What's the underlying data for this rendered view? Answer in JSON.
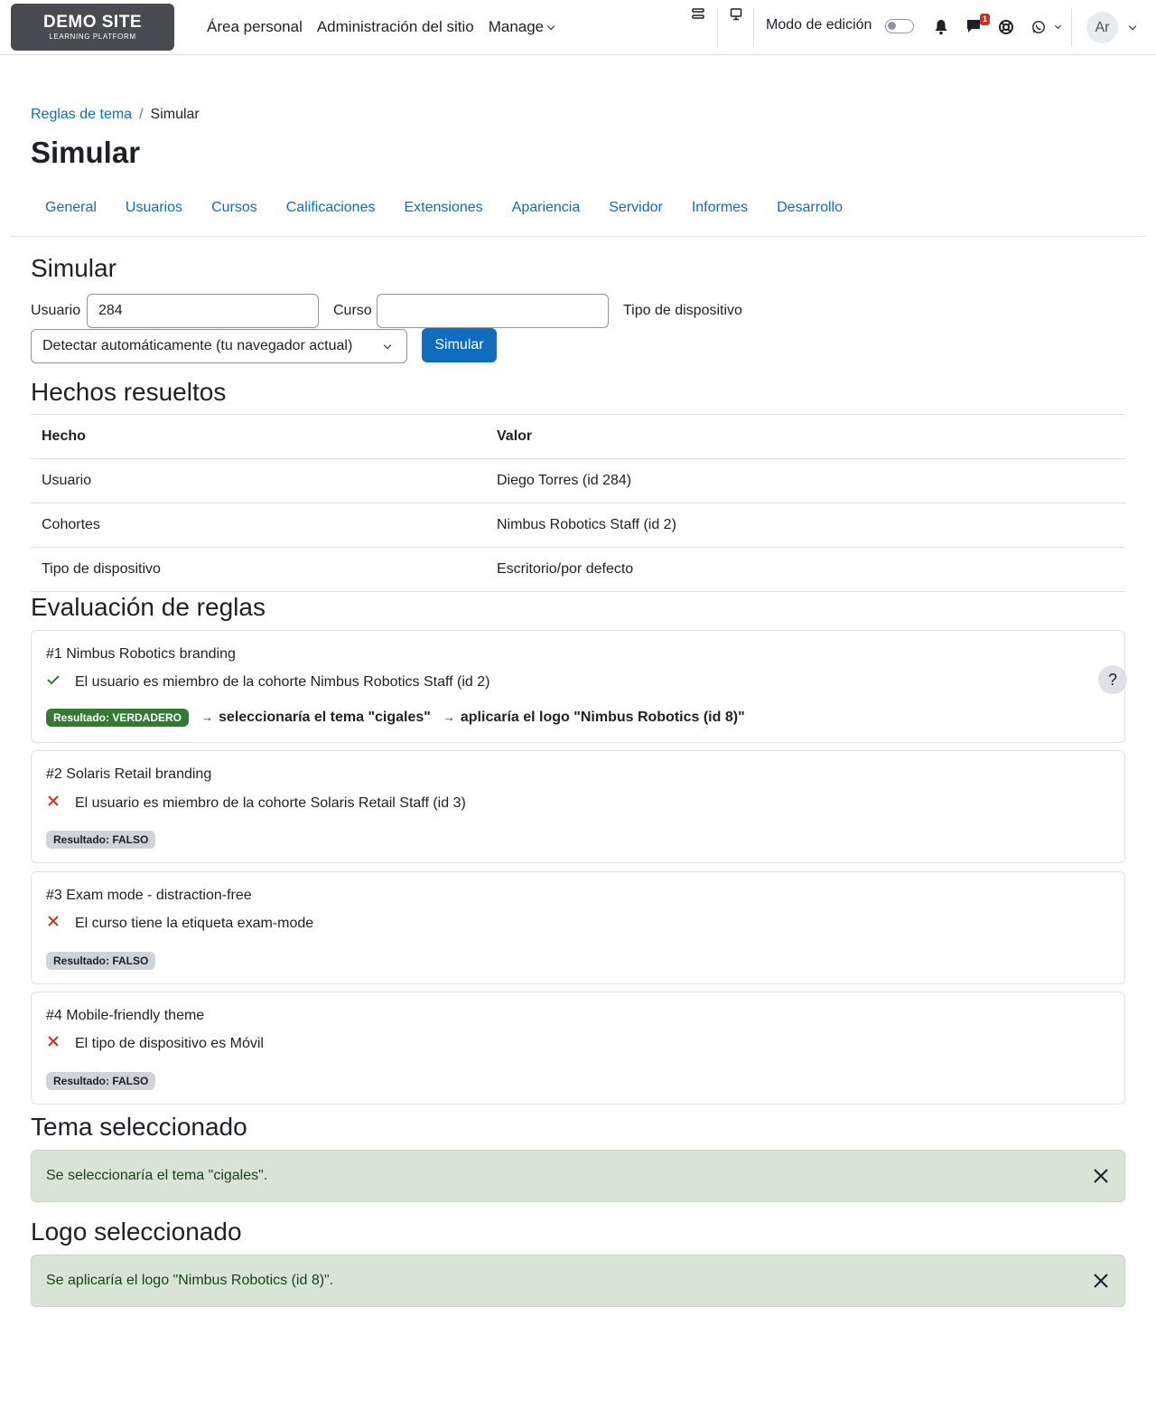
{
  "navbar": {
    "logo_title": "DEMO SITE",
    "logo_subtitle": "LEARNING PLATFORM",
    "primary": [
      "Área personal",
      "Administración del sitio",
      "Manage"
    ],
    "edit_mode_label": "Modo de edición",
    "message_count": "1",
    "avatar_initials": "Ar"
  },
  "breadcrumb": {
    "link": "Reglas de tema",
    "separator": "/",
    "current": "Simular"
  },
  "page_title": "Simular",
  "secondary_nav": [
    "General",
    "Usuarios",
    "Cursos",
    "Calificaciones",
    "Extensiones",
    "Apariencia",
    "Servidor",
    "Informes",
    "Desarrollo"
  ],
  "form": {
    "heading": "Simular",
    "user_label": "Usuario",
    "user_value": "284",
    "course_label": "Curso",
    "course_value": "",
    "device_label": "Tipo de dispositivo",
    "device_selected": "Detectar automáticamente (tu navegador actual)",
    "submit_label": "Simular"
  },
  "facts": {
    "heading": "Hechos resueltos",
    "columns": [
      "Hecho",
      "Valor"
    ],
    "rows": [
      [
        "Usuario",
        "Diego Torres (id 284)"
      ],
      [
        "Cohortes",
        "Nimbus Robotics Staff (id 2)"
      ],
      [
        "Tipo de dispositivo",
        "Escritorio/por defecto"
      ]
    ]
  },
  "evaluation": {
    "heading": "Evaluación de reglas",
    "help_label": "?",
    "rules": [
      {
        "title": "#1 Nimbus Robotics branding",
        "condition": "El usuario es miembro de la cohorte Nimbus Robotics Staff (id 2)",
        "passed": true,
        "result": "Resultado: VERDADERO",
        "actions": [
          "seleccionaría el tema \"cigales\"",
          "aplicaría el logo \"Nimbus Robotics (id 8)\""
        ]
      },
      {
        "title": "#2 Solaris Retail branding",
        "condition": "El usuario es miembro de la cohorte Solaris Retail Staff (id 3)",
        "passed": false,
        "result": "Resultado: FALSO"
      },
      {
        "title": "#3 Exam mode - distraction-free",
        "condition": "El curso tiene la etiqueta exam-mode",
        "passed": false,
        "result": "Resultado: FALSO"
      },
      {
        "title": "#4 Mobile-friendly theme",
        "condition": "El tipo de dispositivo es Móvil",
        "passed": false,
        "result": "Resultado: FALSO"
      }
    ]
  },
  "theme": {
    "heading": "Tema seleccionado",
    "message": "Se seleccionaría el tema \"cigales\"."
  },
  "logo": {
    "heading": "Logo seleccionado",
    "message": "Se aplicaría el logo \"Nimbus Robotics (id 8)\"."
  },
  "colors": {
    "primary": "#0f6cbf",
    "success": "#357a32",
    "alert_bg": "#d7e4d6",
    "error": "#ca3120"
  }
}
